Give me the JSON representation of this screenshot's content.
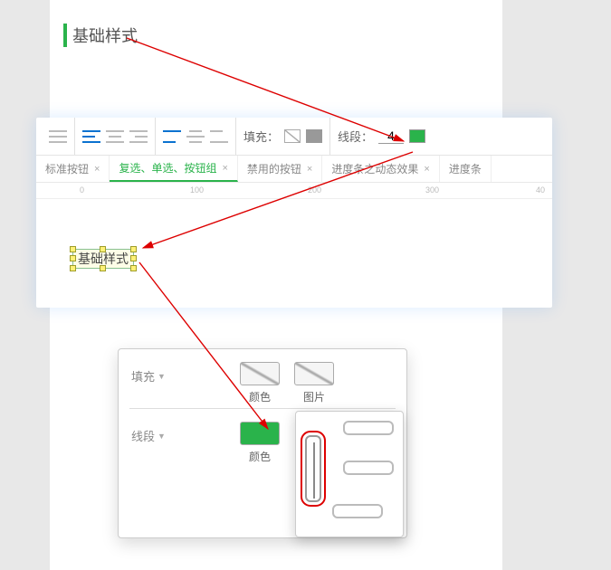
{
  "doc": {
    "title": "基础样式"
  },
  "toolbar": {
    "fill_label": "填充：",
    "line_label": "线段：",
    "line_value": "4"
  },
  "tabs": [
    {
      "label": "标准按钮",
      "active": false
    },
    {
      "label": "复选、单选、按钮组",
      "active": true
    },
    {
      "label": "禁用的按钮",
      "active": false
    },
    {
      "label": "进度条之动态效果",
      "active": false
    },
    {
      "label": "进度条",
      "active": false
    }
  ],
  "ruler": [
    "0",
    "100",
    "200",
    "300",
    "40"
  ],
  "selected": {
    "text": "基础样式"
  },
  "prop": {
    "fill_label": "填充",
    "line_label": "线段",
    "color_label": "颜色",
    "image_label": "图片"
  }
}
